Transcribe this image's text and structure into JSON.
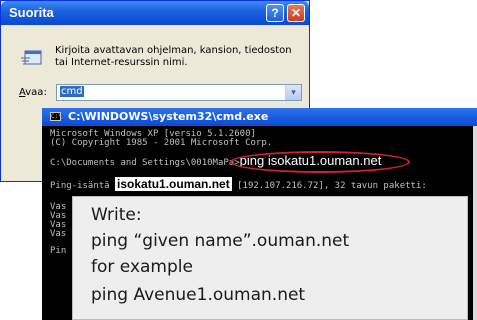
{
  "run_dialog": {
    "title": "Suorita",
    "help_glyph": "?",
    "close_glyph": "✕",
    "description": "Kirjoita avattavan ohjelman, kansion, tiedoston tai Internet-resurssin nimi.",
    "open_label_access": "A",
    "open_label_rest": "vaa:",
    "open_value": "cmd",
    "dropdown_glyph": "▾"
  },
  "cmd_window": {
    "title": "C:\\WINDOWS\\system32\\cmd.exe",
    "icon_glyph": "C:\\",
    "lines": {
      "l1": "Microsoft Windows XP [versio 5.1.2600]",
      "l2": "(C) Copyright 1985 - 2001 Microsoft Corp.",
      "l3_prompt": "C:\\Documents and Settings\\0010MaPa>",
      "l3_command": "ping isokatu1.ouman.net",
      "l4_prefix": "Ping-isäntä ",
      "l4_host": "isokatu1.ouman.net",
      "l4_suffix": " [192.107.216.72], 32 tavun paketti:",
      "l5": "Vas",
      "l6": "Vas",
      "l7": "Vas",
      "l8": "Vas",
      "l9": "Pin"
    }
  },
  "callout": {
    "line1": "Write:",
    "line2": "ping “given name”.ouman.net",
    "line3": "for example",
    "line4": "ping Avenue1.ouman.net"
  },
  "colors": {
    "xp_title_blue": "#0b49d0",
    "highlight_oval": "#d2232a",
    "console_text": "#c0c0c0"
  }
}
